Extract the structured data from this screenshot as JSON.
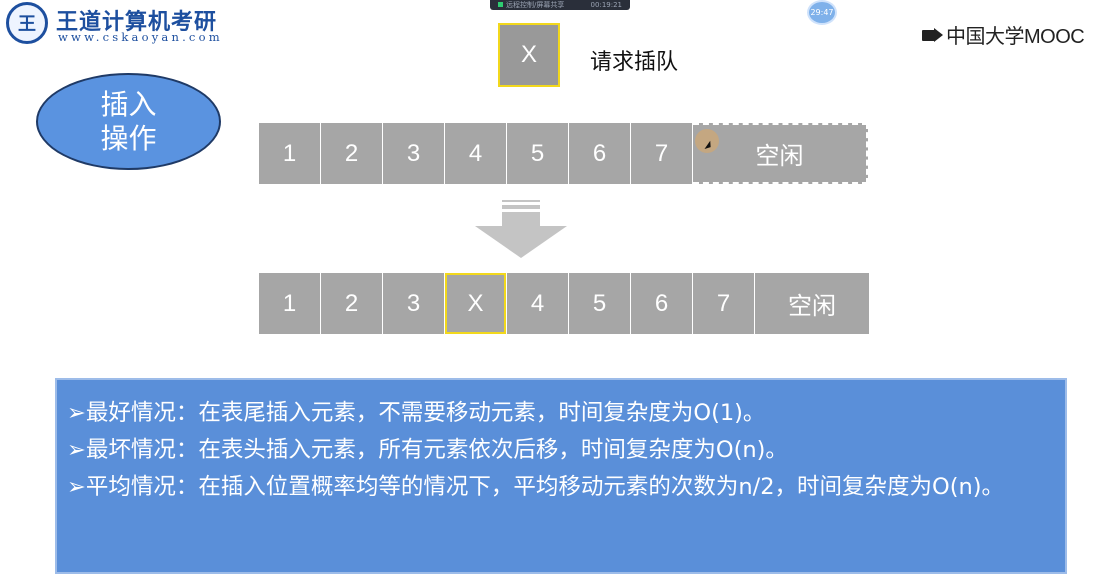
{
  "logo": {
    "emblem_char": "王",
    "title": "王道计算机考研",
    "url": "www.cskaoyan.com"
  },
  "recording_bar": {
    "left_text": "远程控制/屏幕共享",
    "time": "00:19:21"
  },
  "bubble": {
    "text": "29:47"
  },
  "mooc": {
    "text": "中国大学MOOC"
  },
  "request": {
    "element": "X",
    "label": "请求插队"
  },
  "operation": {
    "label": "插入\n操作"
  },
  "before_row": {
    "cells": [
      "1",
      "2",
      "3",
      "4",
      "5",
      "6",
      "7"
    ],
    "free": "空闲"
  },
  "after_row": {
    "cells": [
      "1",
      "2",
      "3",
      "X",
      "4",
      "5",
      "6",
      "7"
    ],
    "free": "空闲"
  },
  "info": {
    "lines": [
      "➢最好情况：在表尾插入元素，不需要移动元素，时间复杂度为O(1)。",
      "➢最坏情况：在表头插入元素，所有元素依次后移，时间复杂度为O(n)。",
      "➢平均情况：在插入位置概率均等的情况下，平均移动元素的次数为n/2，时间复杂度为O(n)。"
    ]
  },
  "colors": {
    "cell": "#a6a6a6",
    "highlight": "#f2d81c",
    "info_bg": "#5a8fd9",
    "ellipse_bg": "#5a93e0"
  }
}
